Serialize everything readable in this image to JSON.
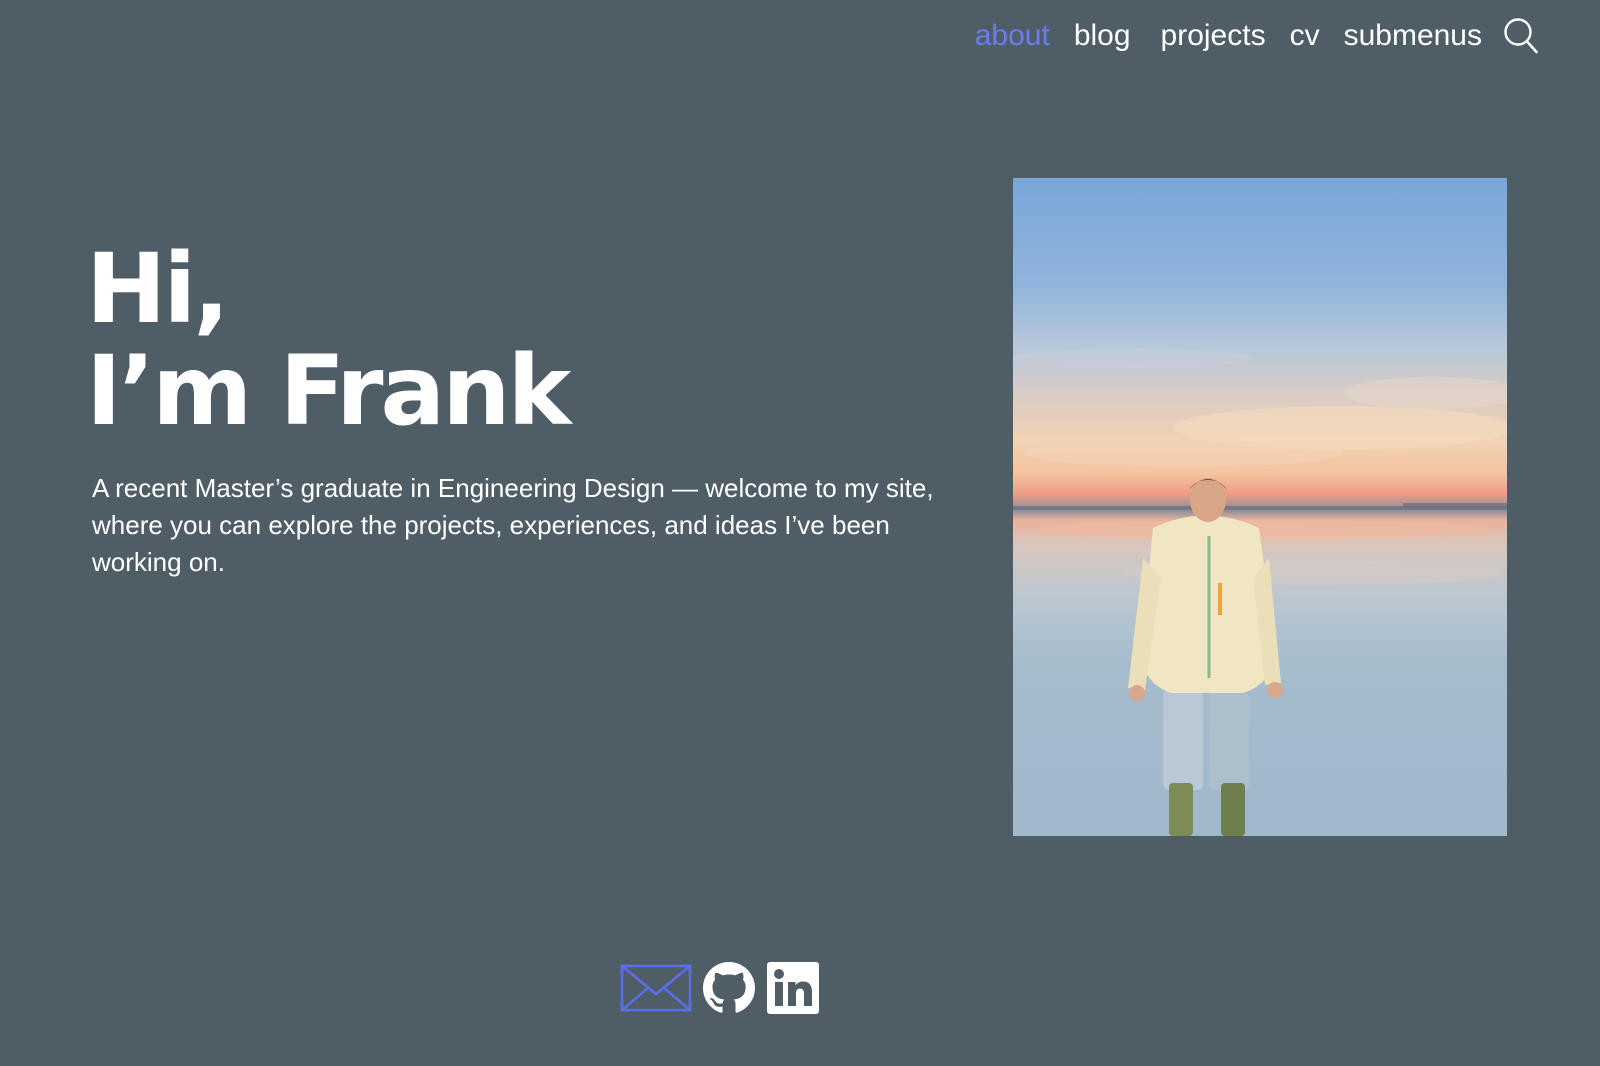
{
  "nav": {
    "items": [
      {
        "label": "about",
        "active": true
      },
      {
        "label": "blog"
      },
      {
        "label": "projects"
      },
      {
        "label": "cv"
      },
      {
        "label": "submenus"
      }
    ],
    "search_icon": "search-icon"
  },
  "hero": {
    "title_line1": "Hi,",
    "title_line2": "I’m Frank",
    "intro": "A recent Master’s graduate in Engineering Design — welcome to my site, where you can explore the projects, experiences, and ideas I’ve been working on."
  },
  "photo": {
    "subject": "person-on-salt-flat-photo"
  },
  "social": {
    "icons": [
      "email-icon",
      "github-icon",
      "linkedin-icon"
    ]
  },
  "colors": {
    "background": "#4f5d67",
    "accent": "#6b7cf2",
    "text": "#ffffff"
  }
}
